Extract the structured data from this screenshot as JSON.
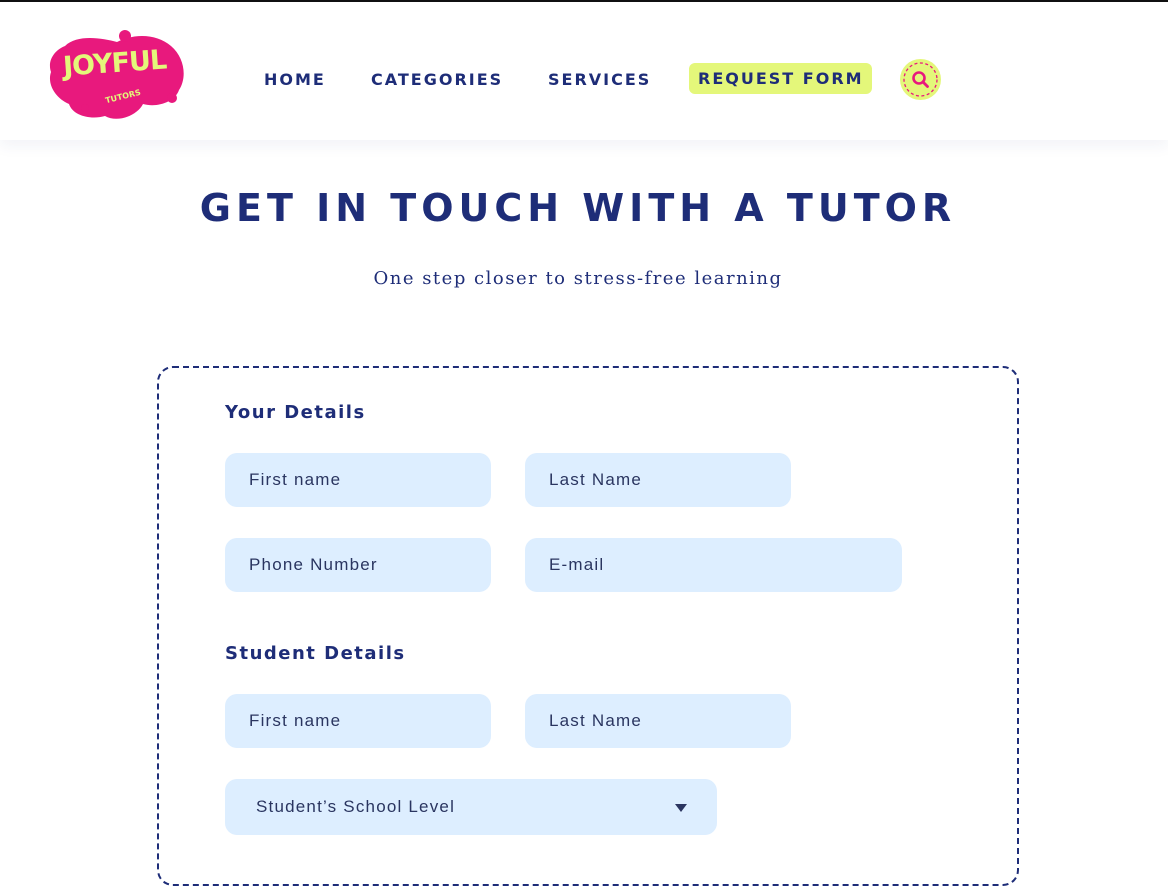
{
  "brand": {
    "name": "JOYFUL",
    "tagline": "TUTORS"
  },
  "nav": {
    "home": "HOME",
    "categories": "CATEGORIES",
    "services": "SERVICES",
    "request_form": "REQUEST FORM"
  },
  "icons": {
    "search": "search-icon",
    "dropdown": "chevron-down-icon"
  },
  "hero": {
    "title": "GET IN TOUCH WITH A TUTOR",
    "subtitle": "One step closer to stress-free learning"
  },
  "form": {
    "your_details": {
      "title": "Your Details",
      "first_name_placeholder": "First name",
      "last_name_placeholder": "Last Name",
      "phone_placeholder": "Phone Number",
      "email_placeholder": "E-mail"
    },
    "student_details": {
      "title": "Student Details",
      "first_name_placeholder": "First name",
      "last_name_placeholder": "Last Name",
      "school_level_value": "Student’s School Level"
    }
  },
  "colors": {
    "navy": "#1e2d78",
    "brand_pink": "#e8197d",
    "accent_lime": "#e4f77a",
    "field_bg": "#ddeeff"
  }
}
